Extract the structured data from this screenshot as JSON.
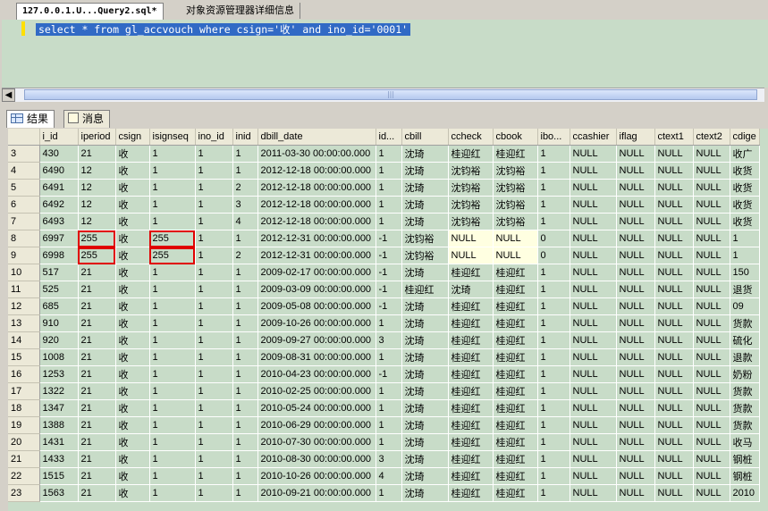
{
  "tabs": [
    {
      "label": "127.0.0.1.U...Query2.sql*"
    },
    {
      "label": "对象资源管理器详细信息"
    }
  ],
  "editor": {
    "sql": "select * from gl_accvouch where csign='收' and ino_id='0001'"
  },
  "result_tabs": [
    {
      "label": "结果"
    },
    {
      "label": "消息"
    }
  ],
  "grid": {
    "columns": [
      "",
      "i_id",
      "iperiod",
      "csign",
      "isignseq",
      "ino_id",
      "inid",
      "dbill_date",
      "id...",
      "cbill",
      "ccheck",
      "cbook",
      "ibo...",
      "ccashier",
      "iflag",
      "ctext1",
      "ctext2",
      "cdige"
    ],
    "rows": [
      [
        "3",
        "430",
        "21",
        "收",
        "1",
        "1",
        "1",
        "2011-03-30 00:00:00.000",
        "1",
        "沈琦",
        "桂迎红",
        "桂迎红",
        "1",
        "NULL",
        "NULL",
        "NULL",
        "NULL",
        "收广"
      ],
      [
        "4",
        "6490",
        "12",
        "收",
        "1",
        "1",
        "1",
        "2012-12-18 00:00:00.000",
        "1",
        "沈琦",
        "沈钧裕",
        "沈钧裕",
        "1",
        "NULL",
        "NULL",
        "NULL",
        "NULL",
        "收货"
      ],
      [
        "5",
        "6491",
        "12",
        "收",
        "1",
        "1",
        "2",
        "2012-12-18 00:00:00.000",
        "1",
        "沈琦",
        "沈钧裕",
        "沈钧裕",
        "1",
        "NULL",
        "NULL",
        "NULL",
        "NULL",
        "收货"
      ],
      [
        "6",
        "6492",
        "12",
        "收",
        "1",
        "1",
        "3",
        "2012-12-18 00:00:00.000",
        "1",
        "沈琦",
        "沈钧裕",
        "沈钧裕",
        "1",
        "NULL",
        "NULL",
        "NULL",
        "NULL",
        "收货"
      ],
      [
        "7",
        "6493",
        "12",
        "收",
        "1",
        "1",
        "4",
        "2012-12-18 00:00:00.000",
        "1",
        "沈琦",
        "沈钧裕",
        "沈钧裕",
        "1",
        "NULL",
        "NULL",
        "NULL",
        "NULL",
        "收货"
      ],
      [
        "8",
        "6997",
        "255",
        "收",
        "255",
        "1",
        "1",
        "2012-12-31 00:00:00.000",
        "-1",
        "沈钧裕",
        "NULL",
        "NULL",
        "0",
        "NULL",
        "NULL",
        "NULL",
        "NULL",
        "1"
      ],
      [
        "9",
        "6998",
        "255",
        "收",
        "255",
        "1",
        "2",
        "2012-12-31 00:00:00.000",
        "-1",
        "沈钧裕",
        "NULL",
        "NULL",
        "0",
        "NULL",
        "NULL",
        "NULL",
        "NULL",
        "1"
      ],
      [
        "10",
        "517",
        "21",
        "收",
        "1",
        "1",
        "1",
        "2009-02-17 00:00:00.000",
        "-1",
        "沈琦",
        "桂迎红",
        "桂迎红",
        "1",
        "NULL",
        "NULL",
        "NULL",
        "NULL",
        "150"
      ],
      [
        "11",
        "525",
        "21",
        "收",
        "1",
        "1",
        "1",
        "2009-03-09 00:00:00.000",
        "-1",
        "桂迎红",
        "沈琦",
        "桂迎红",
        "1",
        "NULL",
        "NULL",
        "NULL",
        "NULL",
        "退货"
      ],
      [
        "12",
        "685",
        "21",
        "收",
        "1",
        "1",
        "1",
        "2009-05-08 00:00:00.000",
        "-1",
        "沈琦",
        "桂迎红",
        "桂迎红",
        "1",
        "NULL",
        "NULL",
        "NULL",
        "NULL",
        "09"
      ],
      [
        "13",
        "910",
        "21",
        "收",
        "1",
        "1",
        "1",
        "2009-10-26 00:00:00.000",
        "1",
        "沈琦",
        "桂迎红",
        "桂迎红",
        "1",
        "NULL",
        "NULL",
        "NULL",
        "NULL",
        "货款"
      ],
      [
        "14",
        "920",
        "21",
        "收",
        "1",
        "1",
        "1",
        "2009-09-27 00:00:00.000",
        "3",
        "沈琦",
        "桂迎红",
        "桂迎红",
        "1",
        "NULL",
        "NULL",
        "NULL",
        "NULL",
        "硫化"
      ],
      [
        "15",
        "1008",
        "21",
        "收",
        "1",
        "1",
        "1",
        "2009-08-31 00:00:00.000",
        "1",
        "沈琦",
        "桂迎红",
        "桂迎红",
        "1",
        "NULL",
        "NULL",
        "NULL",
        "NULL",
        "退款"
      ],
      [
        "16",
        "1253",
        "21",
        "收",
        "1",
        "1",
        "1",
        "2010-04-23 00:00:00.000",
        "-1",
        "沈琦",
        "桂迎红",
        "桂迎红",
        "1",
        "NULL",
        "NULL",
        "NULL",
        "NULL",
        "奶粉"
      ],
      [
        "17",
        "1322",
        "21",
        "收",
        "1",
        "1",
        "1",
        "2010-02-25 00:00:00.000",
        "1",
        "沈琦",
        "桂迎红",
        "桂迎红",
        "1",
        "NULL",
        "NULL",
        "NULL",
        "NULL",
        "货款"
      ],
      [
        "18",
        "1347",
        "21",
        "收",
        "1",
        "1",
        "1",
        "2010-05-24 00:00:00.000",
        "1",
        "沈琦",
        "桂迎红",
        "桂迎红",
        "1",
        "NULL",
        "NULL",
        "NULL",
        "NULL",
        "货款"
      ],
      [
        "19",
        "1388",
        "21",
        "收",
        "1",
        "1",
        "1",
        "2010-06-29 00:00:00.000",
        "1",
        "沈琦",
        "桂迎红",
        "桂迎红",
        "1",
        "NULL",
        "NULL",
        "NULL",
        "NULL",
        "货款"
      ],
      [
        "20",
        "1431",
        "21",
        "收",
        "1",
        "1",
        "1",
        "2010-07-30 00:00:00.000",
        "1",
        "沈琦",
        "桂迎红",
        "桂迎红",
        "1",
        "NULL",
        "NULL",
        "NULL",
        "NULL",
        "收马"
      ],
      [
        "21",
        "1433",
        "21",
        "收",
        "1",
        "1",
        "1",
        "2010-08-30 00:00:00.000",
        "3",
        "沈琦",
        "桂迎红",
        "桂迎红",
        "1",
        "NULL",
        "NULL",
        "NULL",
        "NULL",
        "钢桩"
      ],
      [
        "22",
        "1515",
        "21",
        "收",
        "1",
        "1",
        "1",
        "2010-10-26 00:00:00.000",
        "4",
        "沈琦",
        "桂迎红",
        "桂迎红",
        "1",
        "NULL",
        "NULL",
        "NULL",
        "NULL",
        "钢桩"
      ],
      [
        "23",
        "1563",
        "21",
        "收",
        "1",
        "1",
        "1",
        "2010-09-21 00:00:00.000",
        "1",
        "沈琦",
        "桂迎红",
        "桂迎红",
        "1",
        "NULL",
        "NULL",
        "NULL",
        "NULL",
        "2010"
      ]
    ]
  },
  "colors": {
    "grid_bg": "#c8dcc8",
    "null_bg": "#ffffe1",
    "selection": "#316ac5",
    "highlight_box": "#e00000"
  },
  "icons": {
    "results_tab": "grid-icon",
    "messages_tab": "message-icon",
    "scroll_left": "arrow-left-icon"
  }
}
